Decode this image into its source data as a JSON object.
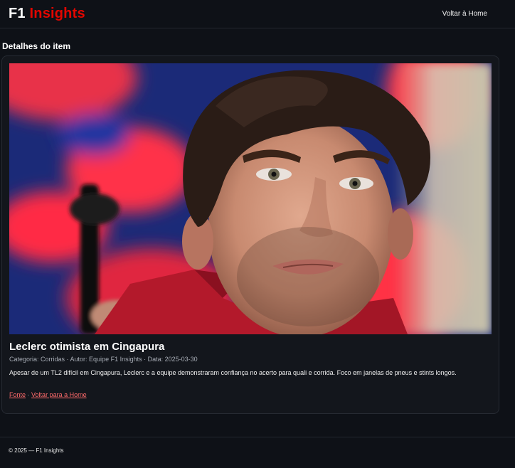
{
  "header": {
    "logo_f1": "F1",
    "logo_insights": "Insights",
    "nav_home": "Voltar à Home"
  },
  "page": {
    "section_title": "Detalhes do item"
  },
  "item": {
    "title": "Leclerc otimista em Cingapura",
    "meta": "Categoria: Corridas · Autor: Equipe F1 Insights · Data: 2025-03-30",
    "description": "Apesar de um TL2 difícil em Cingapura, Leclerc e a equipe demonstraram confiança no acerto para quali e corrida. Foco em janelas de pneus e stints longos.",
    "link_source": "Fonte",
    "separator": "·",
    "link_home": "Voltar para a Home"
  },
  "footer": {
    "text": "© 2025 — F1 Insights"
  },
  "colors": {
    "background": "#0e1117",
    "brand_red": "#e10600",
    "link_red": "#ff6b6b"
  }
}
